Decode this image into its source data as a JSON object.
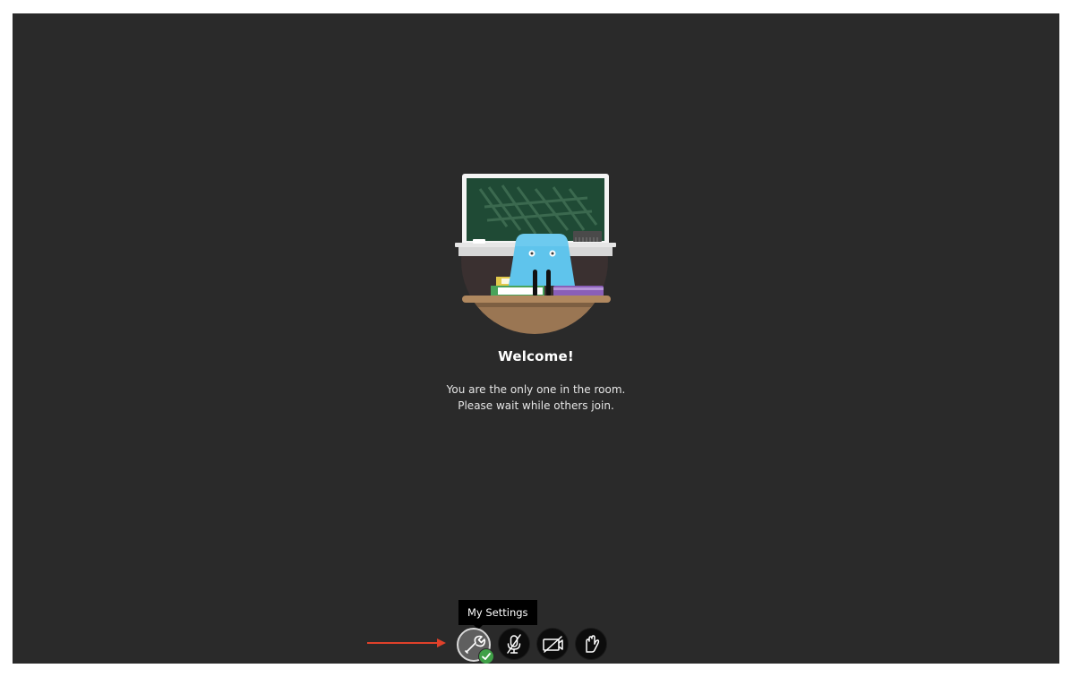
{
  "welcome": {
    "title": "Welcome!",
    "line1": "You are the only one in the room.",
    "line2": "Please wait while others join."
  },
  "tooltip": {
    "text": "My Settings"
  },
  "controls": [
    {
      "name": "my-settings",
      "icon": "wrench-icon",
      "status_icon": "check-icon"
    },
    {
      "name": "microphone",
      "icon": "mic-off-icon"
    },
    {
      "name": "camera",
      "icon": "camera-off-icon"
    },
    {
      "name": "raise-hand",
      "icon": "hand-icon"
    }
  ],
  "colors": {
    "background": "#2a2a2a",
    "annotation_arrow": "#e0412a",
    "status_green": "#3fa047",
    "robot_blue": "#5fc4ec"
  }
}
